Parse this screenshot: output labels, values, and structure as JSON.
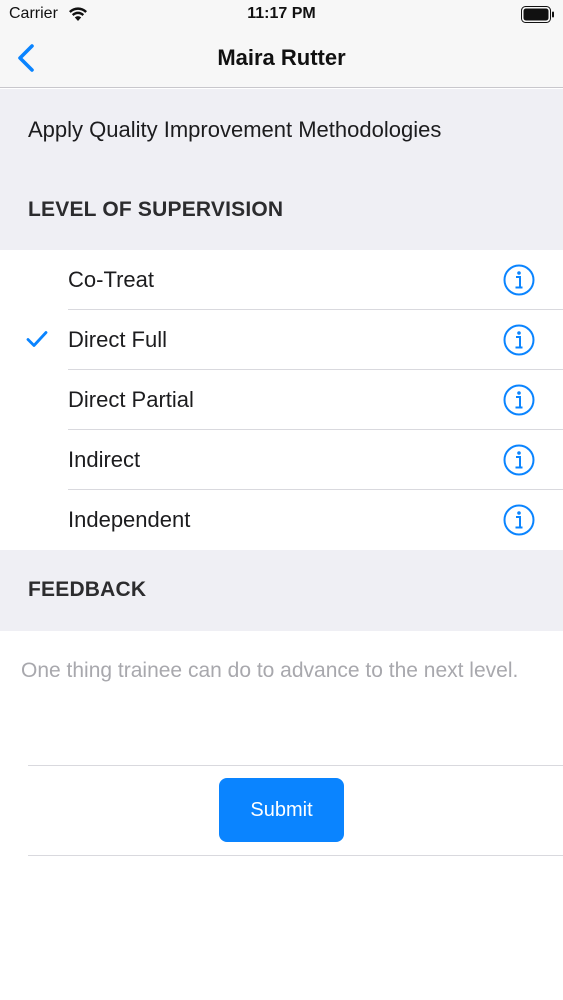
{
  "status_bar": {
    "carrier": "Carrier",
    "time": "11:17 PM",
    "wifi_icon": "wifi-icon",
    "battery_icon": "battery-icon"
  },
  "nav": {
    "back_icon": "chevron-left-icon",
    "title": "Maira Rutter"
  },
  "competency": "Apply Quality Improvement Methodologies",
  "supervision": {
    "header": "LEVEL OF SUPERVISION",
    "options": [
      {
        "label": "Co-Treat",
        "selected": false
      },
      {
        "label": "Direct Full",
        "selected": true
      },
      {
        "label": "Direct Partial",
        "selected": false
      },
      {
        "label": "Indirect",
        "selected": false
      },
      {
        "label": "Independent",
        "selected": false
      }
    ]
  },
  "feedback": {
    "header": "FEEDBACK",
    "value": "",
    "placeholder": "One thing trainee can do to advance to the next level."
  },
  "submit_label": "Submit",
  "colors": {
    "accent": "#0A84FF",
    "background_gray": "#EFEFF4",
    "placeholder": "#A8A8AD"
  }
}
